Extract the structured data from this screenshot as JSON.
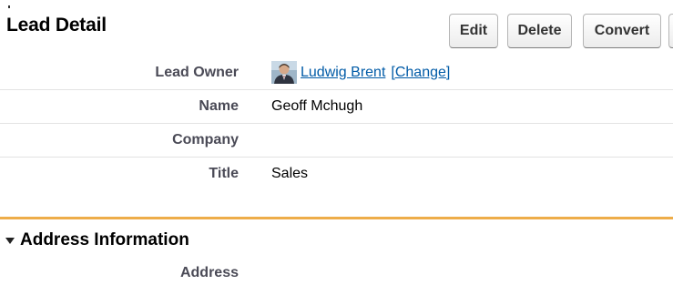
{
  "page_title": "Lead Detail",
  "buttons": {
    "edit": "Edit",
    "delete": "Delete",
    "convert": "Convert"
  },
  "fields": {
    "lead_owner": {
      "label": "Lead Owner",
      "owner_name": "Ludwig Brent",
      "change_link": "[Change]"
    },
    "name": {
      "label": "Name",
      "value": "Geoff Mchugh"
    },
    "company": {
      "label": "Company",
      "value": ""
    },
    "title": {
      "label": "Title",
      "value": "Sales"
    }
  },
  "address_section": {
    "title": "Address Information",
    "address_label": "Address",
    "address_value": ""
  },
  "colors": {
    "section_divider": "#eead49",
    "link": "#015ba7",
    "label": "#4a4a56"
  },
  "icons": {
    "owner_avatar": "user-avatar-icon",
    "section_toggle": "collapse-triangle-icon"
  }
}
